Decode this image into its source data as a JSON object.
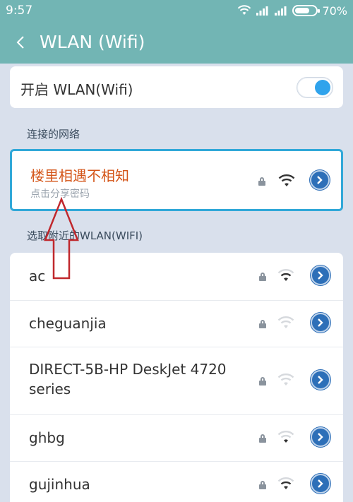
{
  "status_bar": {
    "time": "9:57",
    "battery": "70%",
    "battery_level": 0.7
  },
  "header": {
    "title": "WLAN (Wifi)"
  },
  "wlan_toggle": {
    "label": "开启 WLAN(Wifi)",
    "enabled": true
  },
  "connected_section": {
    "heading": "连接的网络",
    "network": {
      "name": "楼里相遇不相知",
      "subtitle": "点击分享密码"
    }
  },
  "nearby_section": {
    "heading": "选取附近的WLAN(WIFI)",
    "networks": [
      {
        "name": "ac"
      },
      {
        "name": "cheguanjia"
      },
      {
        "name": "DIRECT-5B-HP DeskJet 4720 series"
      },
      {
        "name": "ghbg"
      },
      {
        "name": "gujinhua"
      }
    ]
  },
  "colors": {
    "accent": "#72b5b4",
    "connected_name": "#d4561a",
    "highlight_border": "#31a8d8",
    "toggle_on": "#2fa3ec",
    "annotation_arrow": "#c0282d"
  },
  "icons": {
    "back": "back-chevron-icon",
    "lock": "lock-icon",
    "wifi": "wifi-signal-icon",
    "detail": "chevron-right-circle-icon"
  }
}
